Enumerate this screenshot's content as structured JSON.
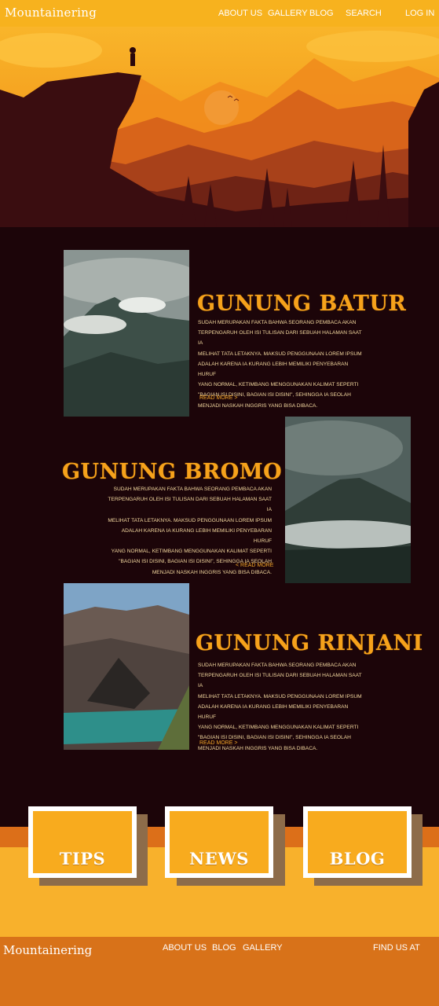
{
  "nav": {
    "brand": "Mountainering",
    "links": [
      "About us",
      "Gallery",
      "Blog",
      "Search",
      "Log in"
    ]
  },
  "mountains": [
    {
      "title": "GUNUNG BATUR",
      "lines": [
        "Sudah merupakan fakta bahwa seorang pembaca akan",
        "terpengaruh oleh isi tulisan dari sebuah halaman saat ia",
        "melihat tata letaknya. Maksud penggunaan Lorem Ipsum",
        "adalah karena ia kurang lebih memiliki penyebaran huruf",
        "yang normal, ketimbang menggunakan kalimat seperti",
        "\"Bagian isi disini, bagian isi disini\", sehingga ia seolah",
        "menjadi naskah Inggris yang bisa dibaca."
      ],
      "more": "Read more >"
    },
    {
      "title": "GUNUNG BROMO",
      "lines": [
        "Sudah merupakan fakta bahwa seorang pembaca akan",
        "terpengaruh oleh isi tulisan dari sebuah halaman saat ia",
        "melihat tata letaknya. Maksud penggunaan Lorem Ipsum",
        "adalah karena ia kurang lebih memiliki penyebaran huruf",
        "yang normal, ketimbang menggunakan kalimat seperti",
        "\"Bagian isi disini, bagian isi disini\", sehingga ia seolah",
        "menjadi naskah Inggris yang bisa dibaca."
      ],
      "more": "< Read more"
    },
    {
      "title": "GUNUNG RINJANI",
      "lines": [
        "Sudah merupakan fakta bahwa seorang pembaca akan",
        "terpengaruh oleh isi tulisan dari sebuah halaman saat ia",
        "melihat tata letaknya. Maksud penggunaan Lorem Ipsum",
        "adalah karena ia kurang lebih memiliki penyebaran huruf",
        "yang normal, ketimbang menggunakan kalimat seperti",
        "\"Bagian isi disini, bagian isi disini\", sehingga ia seolah",
        "menjadi naskah Inggris yang bisa dibaca."
      ],
      "more": "Read more >"
    }
  ],
  "cards": [
    "TIPS",
    "NEWS",
    "BLOG"
  ],
  "footer": {
    "brand": "Mountainering",
    "links": [
      "About us",
      "Blog",
      "Gallery"
    ],
    "find": "Find us at"
  },
  "colors": {
    "nav": "#f7b21e",
    "background": "#1c0509",
    "title": "#f6a21b",
    "footer": "#d87219"
  }
}
